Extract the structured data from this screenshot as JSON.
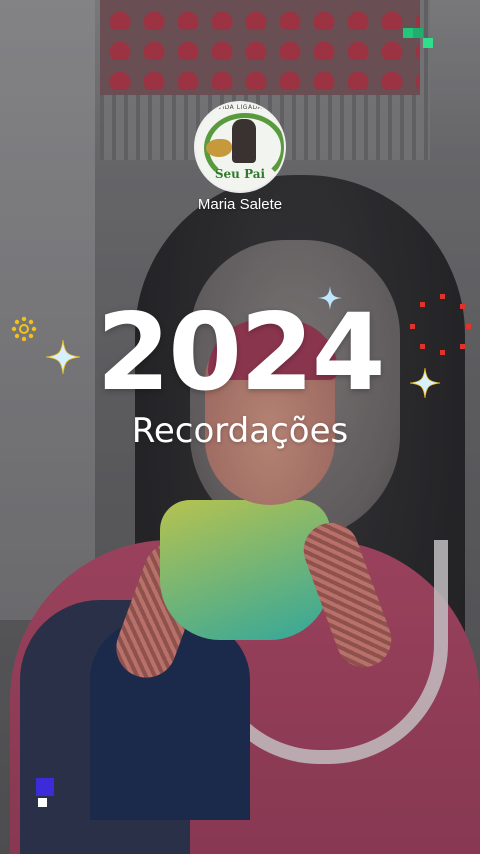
{
  "profile": {
    "avatar_top_text": "VIDA LIGADA",
    "avatar_caption": "Seu Pai",
    "name": "Maria Salete"
  },
  "headline": {
    "year": "2024",
    "subtitle": "Recordações"
  },
  "colors": {
    "text": "#ffffff",
    "pixel_green": "#22c77a",
    "pixel_blue": "#3b2bd8",
    "sparkle_red": "#e0332d",
    "sparkle_yellow": "#f2c21a",
    "sparkle_blue": "#bfe6ff"
  },
  "decor": {
    "icons": [
      "sparkle-icon",
      "sun-flower-icon",
      "red-dots-burst-icon",
      "pixel-squares-icon"
    ]
  }
}
